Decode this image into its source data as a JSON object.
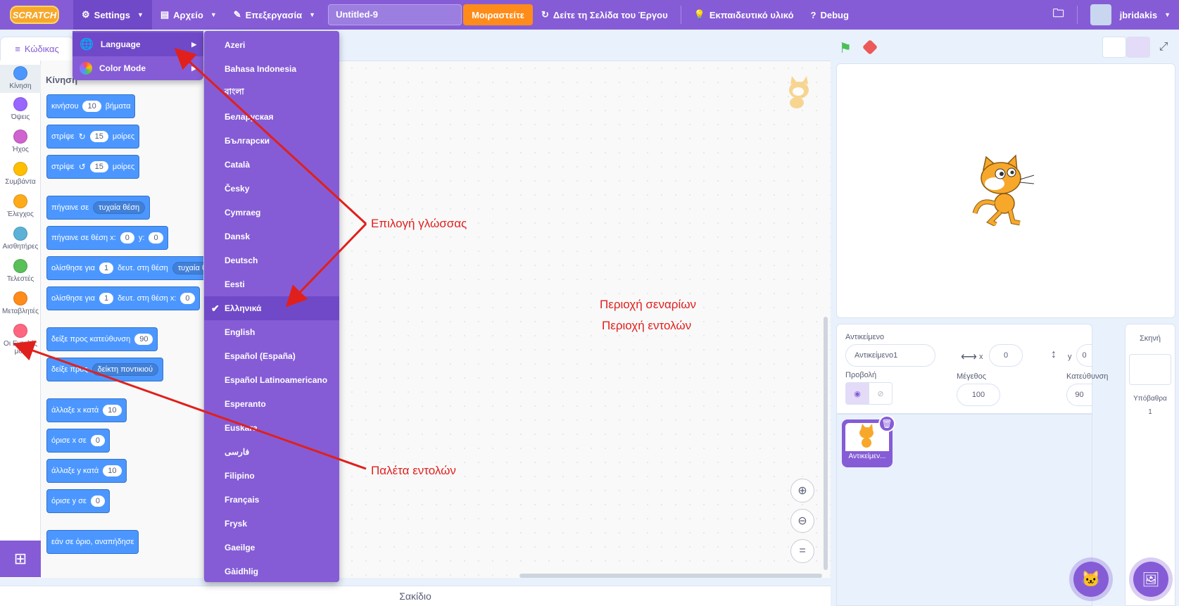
{
  "menubar": {
    "logo": "SCRATCH",
    "settings": "Settings",
    "file": "Αρχείο",
    "edit": "Επεξεργασία",
    "project_title": "Untitled-9",
    "share": "Μοιραστείτε",
    "see_project_page": "Δείτε τη Σελίδα του Έργου",
    "tutorials": "Εκπαιδευτικό υλικό",
    "debug": "Debug",
    "username": "jbridakis"
  },
  "tabs": {
    "code": "Κώδικας"
  },
  "categories": [
    {
      "label": "Κίνηση",
      "color": "#4c97ff"
    },
    {
      "label": "Όψεις",
      "color": "#9966ff"
    },
    {
      "label": "Ήχος",
      "color": "#cf63cf"
    },
    {
      "label": "Συμβάντα",
      "color": "#ffbf00"
    },
    {
      "label": "Έλεγχος",
      "color": "#ffab19"
    },
    {
      "label": "Αισθητήρες",
      "color": "#5cb1d6"
    },
    {
      "label": "Τελεστές",
      "color": "#59c059"
    },
    {
      "label": "Μεταβλητές",
      "color": "#ff8c1a"
    },
    {
      "label": "Οι Εντολές μου",
      "color": "#ff6680"
    }
  ],
  "palette": {
    "heading": "Κίνηση",
    "blocks": [
      {
        "a": "κινήσου",
        "v": "10",
        "b": "βήματα"
      },
      {
        "a": "στρίψε",
        "v": "15",
        "b": "μοίρες"
      },
      {
        "a": "στρίψε",
        "v": "15",
        "b": "μοίρες"
      },
      {
        "a": "πήγαινε σε",
        "dd": "τυχαία θέση"
      },
      {
        "a": "πήγαινε σε θέση x:",
        "v": "0",
        "b": "y:",
        "v2": "0"
      },
      {
        "a": "ολίσθησε για",
        "v": "1",
        "b": "δευτ. στη θέση",
        "dd": "τυχαία θ"
      },
      {
        "a": "ολίσθησε για",
        "v": "1",
        "b": "δευτ. στη θέση x:",
        "v2": "0"
      },
      {
        "a": "δείξε προς κατεύθυνση",
        "v": "90"
      },
      {
        "a": "δείξε προς",
        "dd": "δείκτη ποντικιού"
      },
      {
        "a": "άλλαξε x κατά",
        "v": "10"
      },
      {
        "a": "όρισε x σε",
        "v": "0"
      },
      {
        "a": "άλλαξε y κατά",
        "v": "10"
      },
      {
        "a": "όρισε y σε",
        "v": "0"
      },
      {
        "a": "εάν σε όριο, αναπήδησε"
      }
    ]
  },
  "settings_menu": {
    "language": "Language",
    "color_mode": "Color Mode"
  },
  "languages": [
    "Azeri",
    "Bahasa Indonesia",
    "বাংলা",
    "Беларуская",
    "Български",
    "Català",
    "Česky",
    "Cymraeg",
    "Dansk",
    "Deutsch",
    "Eesti",
    "Ελληνικά",
    "English",
    "Español (España)",
    "Español Latinoamericano",
    "Esperanto",
    "Euskara",
    "فارسی",
    "Filipino",
    "Français",
    "Frysk",
    "Gaeilge",
    "Gàidhlig"
  ],
  "selected_language": "Ελληνικά",
  "backpack": "Σακίδιο",
  "sprite_info": {
    "sprite_label": "Αντικείμενο",
    "sprite_name": "Αντικείμενο1",
    "x_label": "x",
    "x_value": "0",
    "y_label": "y",
    "y_value": "0",
    "show_label": "Προβολή",
    "size_label": "Μέγεθος",
    "size_value": "100",
    "direction_label": "Κατεύθυνση",
    "direction_value": "90"
  },
  "sprite_tile": "Αντικείμεν...",
  "stage_pane": {
    "title": "Σκηνή",
    "backdrops_label": "Υπόβαθρα",
    "backdrops_count": "1"
  },
  "annotations": {
    "language_choice": "Επιλογή γλώσσας",
    "script_area": "Περιοχή σεναρίων",
    "command_area": "Περιοχή εντολών",
    "palette": "Παλέτα εντολών"
  }
}
